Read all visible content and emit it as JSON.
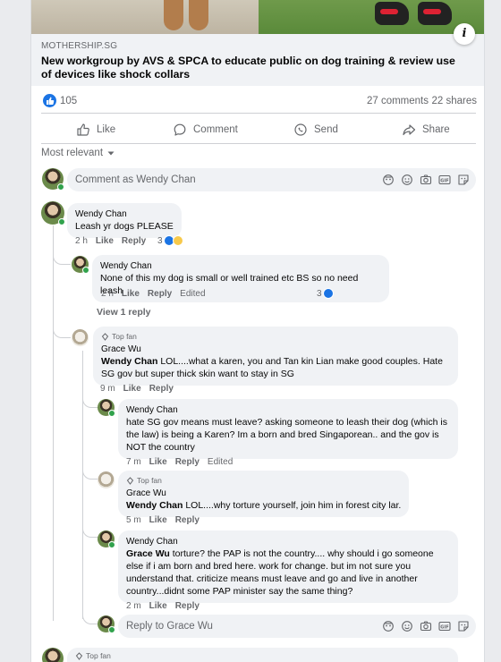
{
  "post": {
    "source": "MOTHERSHIP.SG",
    "headline": "New workgroup by AVS & SPCA to educate public on dog training & review use of devices like shock collars",
    "likes": "105",
    "comments": "27 comments",
    "shares": "22 shares"
  },
  "actions": {
    "like": "Like",
    "comment": "Comment",
    "send": "Send",
    "share": "Share"
  },
  "sort_label": "Most relevant",
  "composer_placeholder": "Comment as Wendy Chan",
  "reply_placeholder": "Reply to Grace Wu",
  "comments": [
    {
      "author": "Wendy Chan",
      "text": "Leash yr dogs PLEASE",
      "time": "2 h",
      "like": "Like",
      "reply": "Reply",
      "reactions": "3"
    },
    {
      "author": "Wendy Chan",
      "text": "None of this my dog is small or well trained etc BS so no need leash",
      "time": "2 h",
      "like": "Like",
      "reply": "Reply",
      "edited": "Edited",
      "reactions": "3"
    },
    {
      "author": "Grace Wu",
      "badge": "Top fan",
      "mention": "Wendy Chan",
      "text": " LOL....what a karen, you and Tan kin Lian make good couples. Hate SG gov but super thick skin want to stay in SG",
      "time": "9 m",
      "like": "Like",
      "reply": "Reply"
    },
    {
      "author": "Wendy Chan",
      "text": "hate SG gov means must leave? asking someone to leash their dog (which is the law) is being a Karen? Im a born and bred Singaporean.. and the gov is NOT the country",
      "time": "7 m",
      "like": "Like",
      "reply": "Reply",
      "edited": "Edited"
    },
    {
      "author": "Grace Wu",
      "badge": "Top fan",
      "mention": "Wendy Chan",
      "text": " LOL....why torture yourself, join him in forest city lar.",
      "time": "5 m",
      "like": "Like",
      "reply": "Reply"
    },
    {
      "author": "Wendy Chan",
      "mention": "Grace Wu",
      "text": " torture? the PAP is not the country.... why should i go someone else if i am born and bred here. work for change. but im not sure you understand that. criticize means must leave and go and live in another country...didnt some PAP minister say the same thing?",
      "time": "2 m",
      "like": "Like",
      "reply": "Reply"
    }
  ],
  "view_reply": "View 1 reply",
  "next_badge": "Top fan",
  "colors": {
    "facebook_blue": "#1b74e4",
    "secondary_text": "#65676b",
    "bubble_bg": "#f0f2f5",
    "online_green": "#31a24c"
  },
  "icons": [
    "info-icon",
    "like-icon",
    "comment-icon",
    "send-icon",
    "share-icon",
    "chevron-down-icon",
    "sticker-icon",
    "emoji-icon",
    "camera-icon",
    "gif-icon",
    "avatar-sticker-icon",
    "top-fan-icon"
  ]
}
